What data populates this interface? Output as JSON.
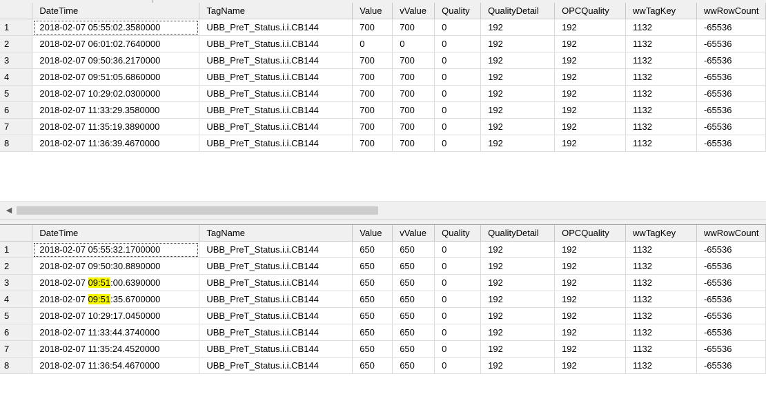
{
  "columns": [
    "DateTime",
    "TagName",
    "Value",
    "vValue",
    "Quality",
    "QualityDetail",
    "OPCQuality",
    "wwTagKey",
    "wwRowCount"
  ],
  "grid_top": {
    "rows": [
      {
        "n": "1",
        "dt": "2018-02-07 05:55:02.3580000",
        "tag": "UBB_PreT_Status.i.i.CB144",
        "value": "700",
        "vvalue": "700",
        "quality": "0",
        "qdetail": "192",
        "opc": "192",
        "key": "1132",
        "row": "-65536"
      },
      {
        "n": "2",
        "dt": "2018-02-07 06:01:02.7640000",
        "tag": "UBB_PreT_Status.i.i.CB144",
        "value": "0",
        "vvalue": "0",
        "quality": "0",
        "qdetail": "192",
        "opc": "192",
        "key": "1132",
        "row": "-65536"
      },
      {
        "n": "3",
        "dt": "2018-02-07 09:50:36.2170000",
        "tag": "UBB_PreT_Status.i.i.CB144",
        "value": "700",
        "vvalue": "700",
        "quality": "0",
        "qdetail": "192",
        "opc": "192",
        "key": "1132",
        "row": "-65536"
      },
      {
        "n": "4",
        "dt": "2018-02-07 09:51:05.6860000",
        "tag": "UBB_PreT_Status.i.i.CB144",
        "value": "700",
        "vvalue": "700",
        "quality": "0",
        "qdetail": "192",
        "opc": "192",
        "key": "1132",
        "row": "-65536"
      },
      {
        "n": "5",
        "dt": "2018-02-07 10:29:02.0300000",
        "tag": "UBB_PreT_Status.i.i.CB144",
        "value": "700",
        "vvalue": "700",
        "quality": "0",
        "qdetail": "192",
        "opc": "192",
        "key": "1132",
        "row": "-65536"
      },
      {
        "n": "6",
        "dt": "2018-02-07 11:33:29.3580000",
        "tag": "UBB_PreT_Status.i.i.CB144",
        "value": "700",
        "vvalue": "700",
        "quality": "0",
        "qdetail": "192",
        "opc": "192",
        "key": "1132",
        "row": "-65536"
      },
      {
        "n": "7",
        "dt": "2018-02-07 11:35:19.3890000",
        "tag": "UBB_PreT_Status.i.i.CB144",
        "value": "700",
        "vvalue": "700",
        "quality": "0",
        "qdetail": "192",
        "opc": "192",
        "key": "1132",
        "row": "-65536"
      },
      {
        "n": "8",
        "dt": "2018-02-07 11:36:39.4670000",
        "tag": "UBB_PreT_Status.i.i.CB144",
        "value": "700",
        "vvalue": "700",
        "quality": "0",
        "qdetail": "192",
        "opc": "192",
        "key": "1132",
        "row": "-65536"
      }
    ]
  },
  "grid_bottom": {
    "rows": [
      {
        "n": "1",
        "dt": "2018-02-07 05:55:32.1700000",
        "tag": "UBB_PreT_Status.i.i.CB144",
        "value": "650",
        "vvalue": "650",
        "quality": "0",
        "qdetail": "192",
        "opc": "192",
        "key": "1132",
        "row": "-65536"
      },
      {
        "n": "2",
        "dt": "2018-02-07 09:50:30.8890000",
        "tag": "UBB_PreT_Status.i.i.CB144",
        "value": "650",
        "vvalue": "650",
        "quality": "0",
        "qdetail": "192",
        "opc": "192",
        "key": "1132",
        "row": "-65536"
      },
      {
        "n": "3",
        "dt_pre": "2018-02-07 ",
        "dt_hl": "09:51",
        "dt_post": ":00.6390000",
        "tag": "UBB_PreT_Status.i.i.CB144",
        "value": "650",
        "vvalue": "650",
        "quality": "0",
        "qdetail": "192",
        "opc": "192",
        "key": "1132",
        "row": "-65536"
      },
      {
        "n": "4",
        "dt_pre": "2018-02-07 ",
        "dt_hl": "09:51",
        "dt_post": ":35.6700000",
        "tag": "UBB_PreT_Status.i.i.CB144",
        "value": "650",
        "vvalue": "650",
        "quality": "0",
        "qdetail": "192",
        "opc": "192",
        "key": "1132",
        "row": "-65536"
      },
      {
        "n": "5",
        "dt": "2018-02-07 10:29:17.0450000",
        "tag": "UBB_PreT_Status.i.i.CB144",
        "value": "650",
        "vvalue": "650",
        "quality": "0",
        "qdetail": "192",
        "opc": "192",
        "key": "1132",
        "row": "-65536"
      },
      {
        "n": "6",
        "dt": "2018-02-07 11:33:44.3740000",
        "tag": "UBB_PreT_Status.i.i.CB144",
        "value": "650",
        "vvalue": "650",
        "quality": "0",
        "qdetail": "192",
        "opc": "192",
        "key": "1132",
        "row": "-65536"
      },
      {
        "n": "7",
        "dt": "2018-02-07 11:35:24.4520000",
        "tag": "UBB_PreT_Status.i.i.CB144",
        "value": "650",
        "vvalue": "650",
        "quality": "0",
        "qdetail": "192",
        "opc": "192",
        "key": "1132",
        "row": "-65536"
      },
      {
        "n": "8",
        "dt": "2018-02-07 11:36:54.4670000",
        "tag": "UBB_PreT_Status.i.i.CB144",
        "value": "650",
        "vvalue": "650",
        "quality": "0",
        "qdetail": "192",
        "opc": "192",
        "key": "1132",
        "row": "-65536"
      }
    ]
  },
  "highlight_color": "#f5f500",
  "scrollbar": {
    "left_arrow_icon": "chevron-left-icon"
  }
}
